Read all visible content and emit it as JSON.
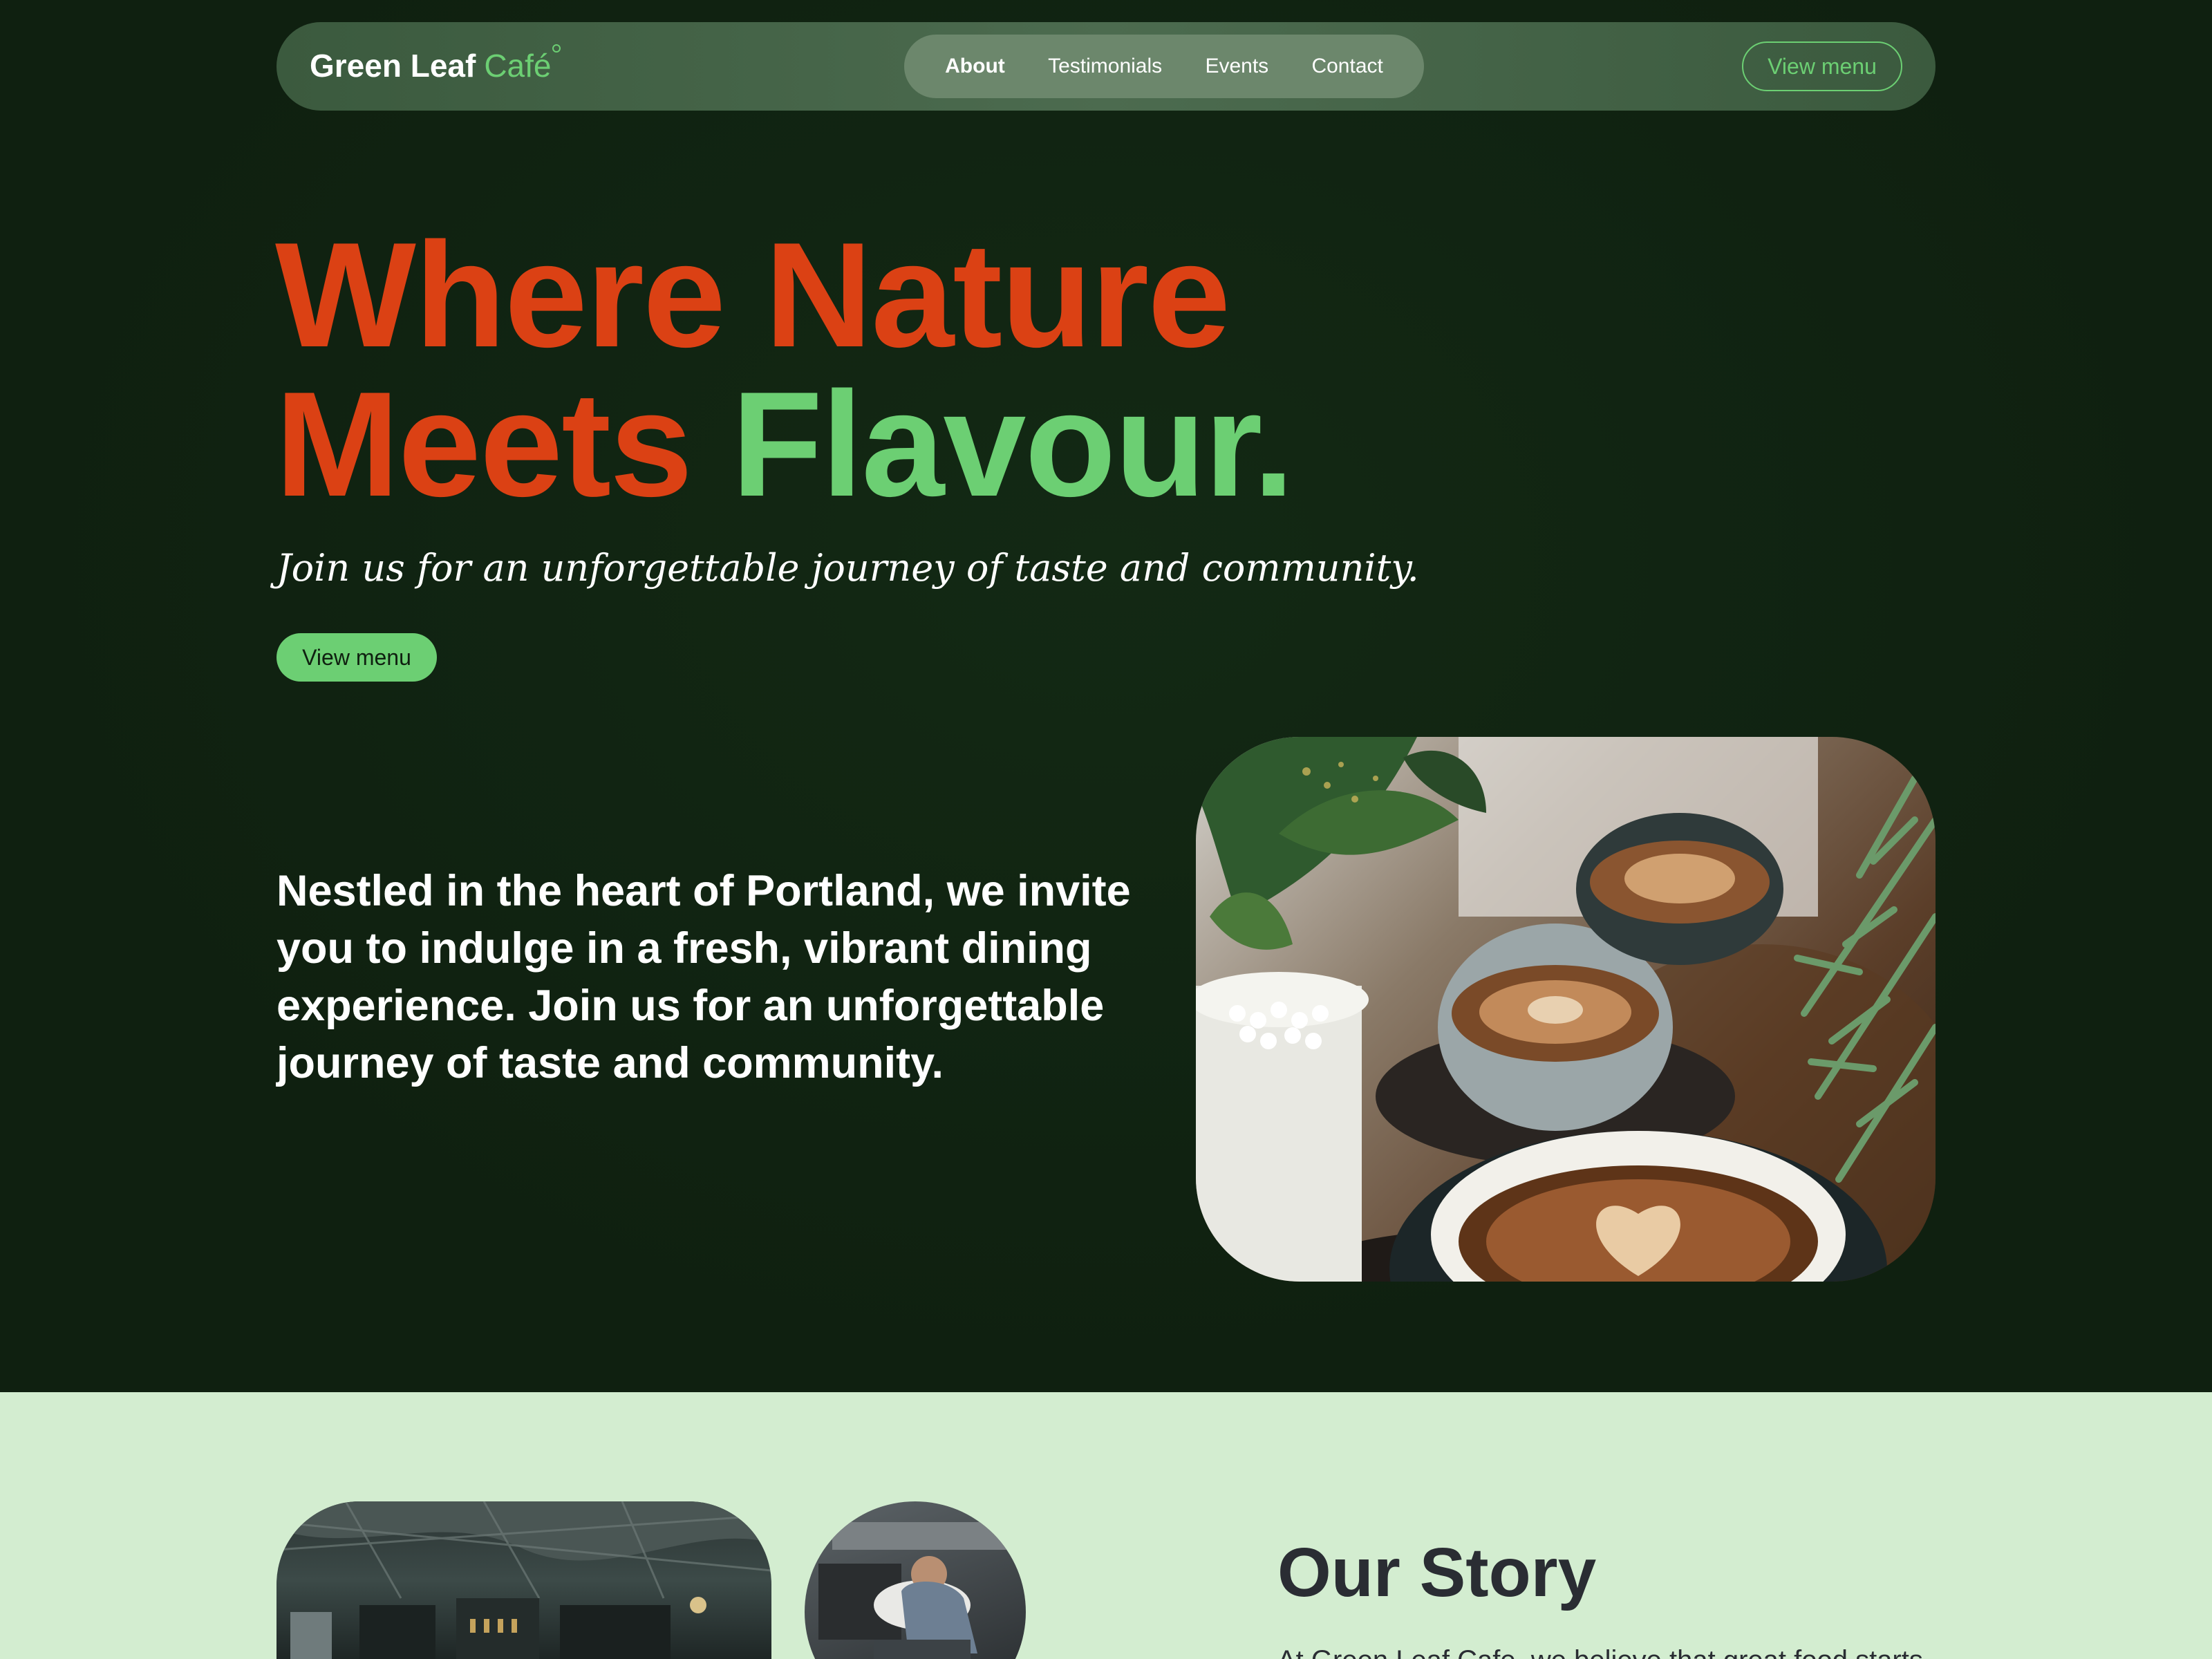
{
  "nav": {
    "brand": "Green Leaf",
    "brand_accent": "Café",
    "links": [
      {
        "label": "About",
        "active": true
      },
      {
        "label": "Testimonials",
        "active": false
      },
      {
        "label": "Events",
        "active": false
      },
      {
        "label": "Contact",
        "active": false
      }
    ],
    "cta_label": "View menu"
  },
  "hero": {
    "headline_line1": "Where Nature",
    "headline_line2_a": "Meets",
    "headline_line2_b": "Flavour.",
    "tagline": "Join us for an unforgettable journey of taste and community.",
    "cta_label": "View menu",
    "intro": "Nestled in the heart of Portland, we invite you to indulge in a fresh, vibrant dining experience. Join us for an unforgettable journey of taste and community."
  },
  "story": {
    "title": "Our Story",
    "text_partial": "At Green Leaf Cafe, we believe that great food starts"
  },
  "colors": {
    "background": "#0f2010",
    "accent_green": "#6ccf73",
    "accent_orange": "#db4114",
    "story_background": "#d3edd0"
  }
}
